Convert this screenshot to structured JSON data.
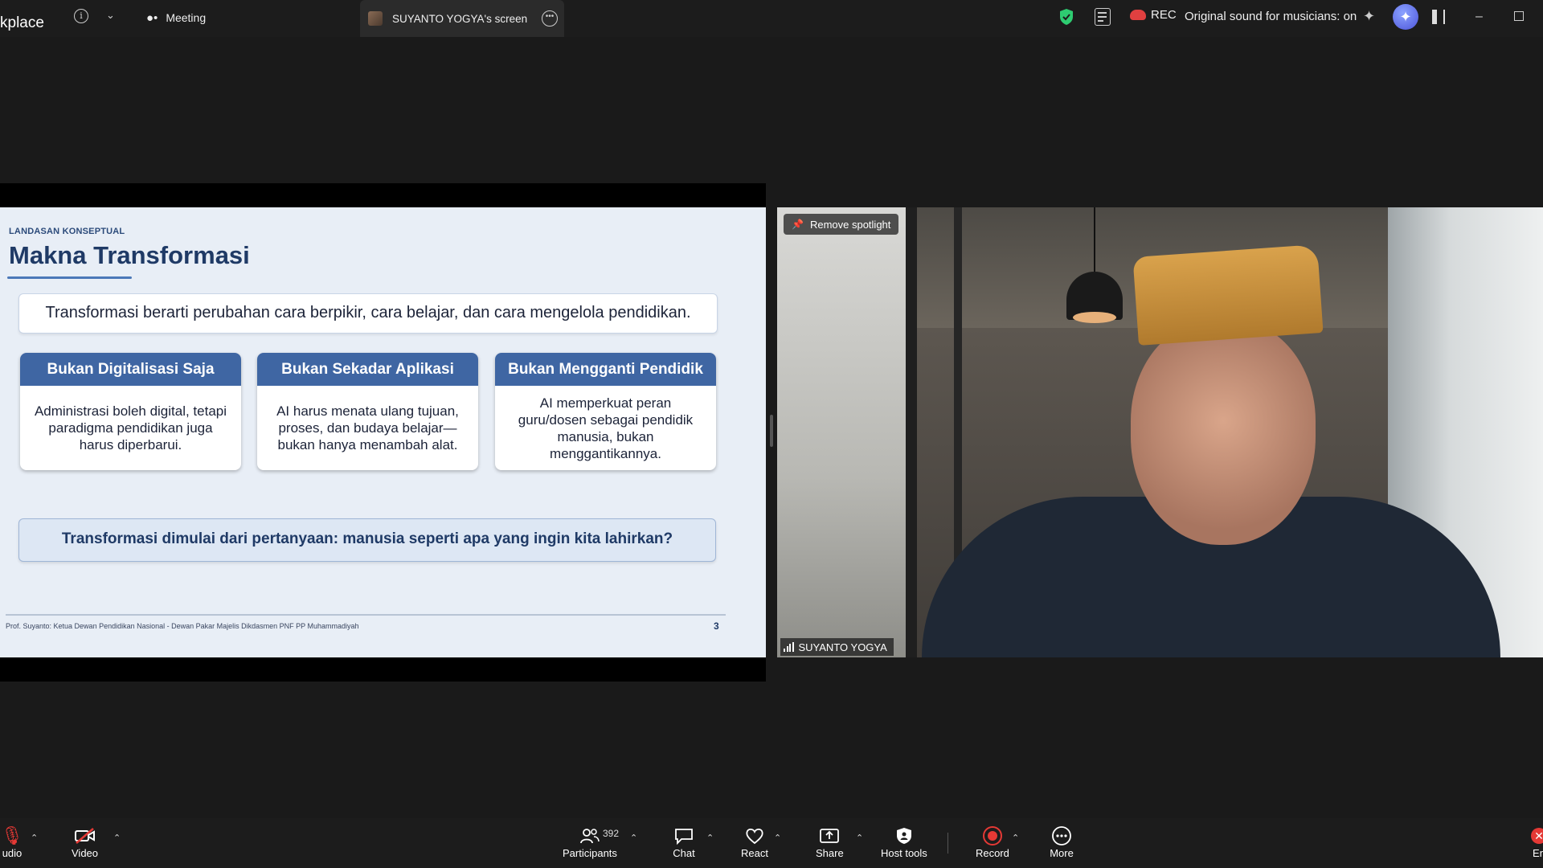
{
  "topbar": {
    "app_title": "kplace",
    "meeting_tab": "Meeting",
    "screen_tab": "SUYANTO YOGYA's screen",
    "rec_label": "REC",
    "sound_label": "Original sound for musicians: on",
    "accent_rec": "#e04040",
    "accent_shield": "#2ecc71"
  },
  "slide": {
    "kicker": "LANDASAN KONSEPTUAL",
    "title": "Makna Transformasi",
    "lead": "Transformasi berarti perubahan cara berpikir, cara belajar, dan cara mengelola pendidikan.",
    "cards": [
      {
        "heading": "Bukan Digitalisasi Saja",
        "body": "Administrasi boleh digital, tetapi paradigma pendidikan juga harus diperbarui."
      },
      {
        "heading": "Bukan Sekadar Aplikasi",
        "body": "AI harus menata ulang tujuan, proses, dan budaya belajar—bukan hanya menambah alat."
      },
      {
        "heading": "Bukan Mengganti Pendidik",
        "body": "AI memperkuat peran guru/dosen sebagai pendidik manusia, bukan menggantikannya."
      }
    ],
    "question": "Transformasi dimulai dari pertanyaan: manusia seperti apa yang ingin kita lahirkan?",
    "footer": "Prof. Suyanto: Ketua Dewan Pendidikan Nasional - Dewan Pakar Majelis Dikdasmen PNF PP Muhammadiyah",
    "page_number": "3",
    "accent": "#3f66a3"
  },
  "video": {
    "spotlight_label": "Remove spotlight",
    "participant_name": "SUYANTO YOGYA"
  },
  "toolbar": {
    "audio_label": "udio",
    "video_label": "Video",
    "participants_label": "Participants",
    "participants_count": "392",
    "chat_label": "Chat",
    "react_label": "React",
    "share_label": "Share",
    "host_tools_label": "Host tools",
    "record_label": "Record",
    "more_label": "More",
    "end_label": "En"
  }
}
